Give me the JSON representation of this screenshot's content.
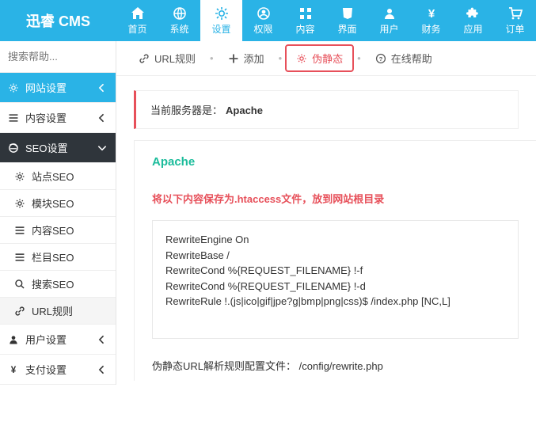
{
  "brand": "迅睿 CMS",
  "topnav": [
    {
      "label": "首页",
      "icon": "home"
    },
    {
      "label": "系统",
      "icon": "globe"
    },
    {
      "label": "设置",
      "icon": "cogs",
      "active": true
    },
    {
      "label": "权限",
      "icon": "user-circle"
    },
    {
      "label": "内容",
      "icon": "grid"
    },
    {
      "label": "界面",
      "icon": "html5"
    },
    {
      "label": "用户",
      "icon": "user"
    },
    {
      "label": "财务",
      "icon": "yen"
    },
    {
      "label": "应用",
      "icon": "puzzle"
    },
    {
      "label": "订单",
      "icon": "cart"
    }
  ],
  "search_placeholder": "搜索帮助...",
  "sidebar": {
    "groups": [
      {
        "icon": "cog",
        "label": "网站设置",
        "type": "blue",
        "chev": "left"
      },
      {
        "icon": "bars",
        "label": "内容设置",
        "type": "plain",
        "chev": "left"
      },
      {
        "icon": "ie",
        "label": "SEO设置",
        "type": "dark",
        "chev": "down"
      },
      {
        "icon": "user",
        "label": "用户设置",
        "type": "plain",
        "chev": "left"
      },
      {
        "icon": "yen",
        "label": "支付设置",
        "type": "plain",
        "chev": "left"
      }
    ],
    "seo_sub": [
      {
        "icon": "cog",
        "label": "站点SEO"
      },
      {
        "icon": "cog",
        "label": "模块SEO"
      },
      {
        "icon": "bars",
        "label": "内容SEO"
      },
      {
        "icon": "bars",
        "label": "栏目SEO"
      },
      {
        "icon": "search",
        "label": "搜索SEO"
      },
      {
        "icon": "link",
        "label": "URL规则",
        "sel": true
      }
    ]
  },
  "tabs": [
    {
      "icon": "link",
      "label": "URL规则"
    },
    {
      "icon": "plus",
      "label": "添加"
    },
    {
      "icon": "cog",
      "label": "伪静态",
      "active": true
    },
    {
      "icon": "help",
      "label": "在线帮助"
    }
  ],
  "info_prefix": "当前服务器是：",
  "info_value": "Apache",
  "panel_title": "Apache",
  "panel_warn": "将以下内容保存为.htaccess文件，放到网站根目录",
  "code": "RewriteEngine On\nRewriteBase /\nRewriteCond %{REQUEST_FILENAME} !-f\nRewriteCond %{REQUEST_FILENAME} !-d\nRewriteRule !.(js|ico|gif|jpe?g|bmp|png|css)$ /index.php [NC,L]",
  "config_note": "伪静态URL解析规则配置文件： /config/rewrite.php"
}
